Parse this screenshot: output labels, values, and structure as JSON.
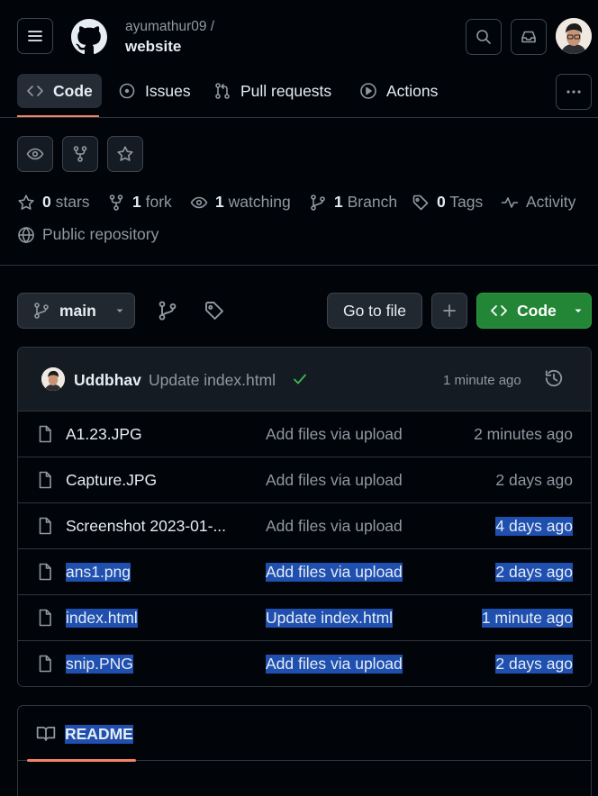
{
  "header": {
    "owner": "ayumathur09 /",
    "repo": "website"
  },
  "tabs": [
    {
      "label": "Code",
      "icon": "code-icon",
      "active": true
    },
    {
      "label": "Issues",
      "icon": "issue-icon"
    },
    {
      "label": "Pull requests",
      "icon": "pull-request-icon"
    },
    {
      "label": "Actions",
      "icon": "play-icon"
    }
  ],
  "stats": {
    "stars_count": "0",
    "stars_label": "stars",
    "forks_count": "1",
    "forks_label": "fork",
    "watching_count": "1",
    "watching_label": "watching",
    "branch_count": "1",
    "branch_label": "Branch",
    "tags_count": "0",
    "tags_label": "Tags",
    "activity_label": "Activity",
    "visibility": "Public repository"
  },
  "branch_bar": {
    "branch": "main",
    "go_to_file": "Go to file",
    "add": "+",
    "code_button": "Code"
  },
  "latest_commit": {
    "author": "Uddbhav",
    "message": "Update index.html",
    "time": "1 minute ago"
  },
  "files": [
    {
      "name": "A1.23.JPG",
      "message": "Add files via upload",
      "time": "2 minutes ago"
    },
    {
      "name": "Capture.JPG",
      "message": "Add files via upload",
      "time": "2 days ago"
    },
    {
      "name": "Screenshot 2023-01-...",
      "message": "Add files via upload",
      "time": "4 days ago"
    },
    {
      "name": "ans1.png",
      "message": "Add files via upload",
      "time": "2 days ago"
    },
    {
      "name": "index.html",
      "message": "Update index.html",
      "time": "1 minute ago"
    },
    {
      "name": "snip.PNG",
      "message": "Add files via upload",
      "time": "2 days ago"
    }
  ],
  "readme": {
    "tab_label": "README"
  },
  "colors": {
    "background": "#010409",
    "accent_underline": "#f78166",
    "code_button": "#238636",
    "selection": "#1f4faf"
  }
}
